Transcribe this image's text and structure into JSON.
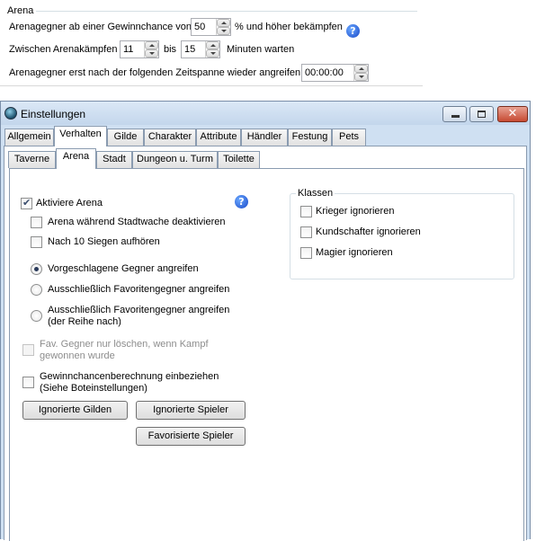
{
  "arena_panel": {
    "title": "Arena",
    "row1": {
      "prefix": "Arenagegner ab einer Gewinnchance von",
      "value": "50",
      "suffix": "% und höher bekämpfen"
    },
    "row2": {
      "prefix": "Zwischen Arenakämpfen",
      "from_value": "11",
      "between": "bis",
      "to_value": "15",
      "suffix": "Minuten warten"
    },
    "row3": {
      "label": "Arenagegner erst nach der folgenden Zeitspanne wieder angreifen:",
      "value": "00:00:00"
    },
    "help_glyph": "?"
  },
  "window": {
    "title": "Einstellungen",
    "icon": "app-globe-icon",
    "controls": {
      "close_glyph": "✕"
    },
    "tabs": [
      "Allgemein",
      "Verhalten",
      "Gilde",
      "Charakter",
      "Attribute",
      "Händler",
      "Festung",
      "Pets"
    ],
    "active_tab": "Verhalten",
    "subtabs": [
      "Taverne",
      "Arena",
      "Stadt",
      "Dungeon u. Turm",
      "Toilette"
    ],
    "active_subtab": "Arena"
  },
  "arena_tab": {
    "activate": {
      "label": "Aktiviere Arena",
      "checked": true
    },
    "disable_guard": {
      "label": "Arena während Stadtwache deaktivieren",
      "checked": false
    },
    "stop_after": {
      "label": "Nach 10 Siegen aufhören",
      "checked": false
    },
    "radios": [
      {
        "label": "Vorgeschlagene Gegner angreifen",
        "checked": true
      },
      {
        "label": "Ausschließlich Favoritengegner angreifen",
        "checked": false
      },
      {
        "label_line1": "Ausschließlich Favoritengegner angreifen",
        "label_line2": "(der Reihe nach)",
        "checked": false
      }
    ],
    "fav_delete": {
      "line1": "Fav. Gegner nur löschen, wenn Kampf",
      "line2": "gewonnen wurde",
      "checked": false,
      "enabled": false
    },
    "win_calc": {
      "line1": "Gewinnchancenberechnung einbeziehen",
      "line2": "(Siehe Boteinstellungen)",
      "checked": false
    },
    "buttons": {
      "ignored_guilds": "Ignorierte Gilden",
      "ignored_players": "Ignorierte Spieler",
      "favorite_players": "Favorisierte Spieler"
    },
    "classes": {
      "title": "Klassen",
      "items": [
        {
          "label": "Krieger ignorieren",
          "checked": false
        },
        {
          "label": "Kundschafter ignorieren",
          "checked": false
        },
        {
          "label": "Magier ignorieren",
          "checked": false
        }
      ]
    },
    "help_glyph": "?"
  }
}
